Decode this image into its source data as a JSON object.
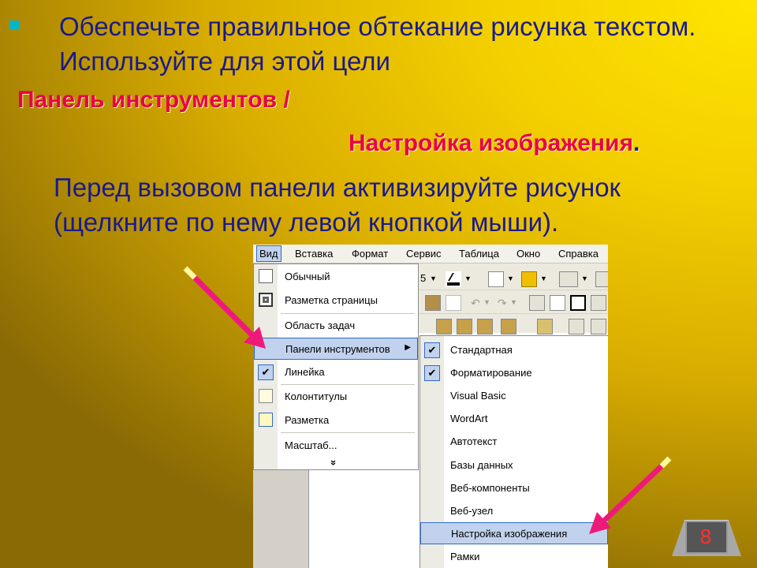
{
  "slide": {
    "bullet_text": "Обеспечьте правильное обтекание рисунка текстом. Используйте для этой цели",
    "toolbar_path_part1": "Панель инструментов /",
    "toolbar_path_part2": "Настройка изображения",
    "toolbar_path_dot": ".",
    "hint_text": "Перед вызовом панели активизируйте рисунок (щелкните по нему левой кнопкой мыши).",
    "page_number": "8"
  },
  "menubar": {
    "items": [
      "Вид",
      "Вставка",
      "Формат",
      "Сервис",
      "Таблица",
      "Окно",
      "Справка"
    ]
  },
  "toolbar": {
    "font_size_fragment": "5"
  },
  "view_menu": {
    "items": [
      "Обычный",
      "Разметка страницы",
      "Область задач",
      "Панели инструментов",
      "Линейка",
      "Колонтитулы",
      "Разметка",
      "Масштаб...",
      "»"
    ]
  },
  "toolbars_submenu": {
    "items": [
      "Стандартная",
      "Форматирование",
      "Visual Basic",
      "WordArt",
      "Автотекст",
      "Базы данных",
      "Веб-компоненты",
      "Веб-узел",
      "Настройка изображения",
      "Рамки"
    ],
    "checked": [
      "Стандартная",
      "Форматирование"
    ]
  },
  "colors": {
    "body_text": "#1a1a8c",
    "accent_magenta": "#e8004a",
    "arrow": "#ee1a7a",
    "menu_highlight": "#c1d2ee",
    "bullet": "#00b7c9"
  }
}
